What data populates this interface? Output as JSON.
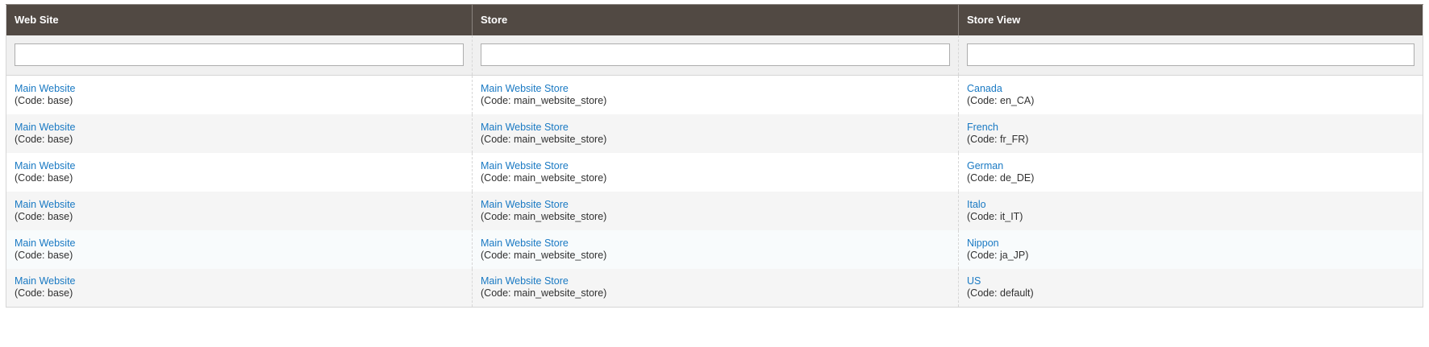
{
  "columns": {
    "website": "Web Site",
    "store": "Store",
    "store_view": "Store View"
  },
  "filters": {
    "website": "",
    "store": "",
    "store_view": ""
  },
  "rows": [
    {
      "website": {
        "name": "Main Website",
        "code": "(Code: base)"
      },
      "store": {
        "name": "Main Website Store",
        "code": "(Code: main_website_store)"
      },
      "store_view": {
        "name": "Canada",
        "code": "(Code: en_CA)"
      }
    },
    {
      "website": {
        "name": "Main Website",
        "code": "(Code: base)"
      },
      "store": {
        "name": "Main Website Store",
        "code": "(Code: main_website_store)"
      },
      "store_view": {
        "name": "French",
        "code": "(Code: fr_FR)"
      }
    },
    {
      "website": {
        "name": "Main Website",
        "code": "(Code: base)"
      },
      "store": {
        "name": "Main Website Store",
        "code": "(Code: main_website_store)"
      },
      "store_view": {
        "name": "German",
        "code": "(Code: de_DE)"
      }
    },
    {
      "website": {
        "name": "Main Website",
        "code": "(Code: base)"
      },
      "store": {
        "name": "Main Website Store",
        "code": "(Code: main_website_store)"
      },
      "store_view": {
        "name": "Italo",
        "code": "(Code: it_IT)"
      }
    },
    {
      "website": {
        "name": "Main Website",
        "code": "(Code: base)"
      },
      "store": {
        "name": "Main Website Store",
        "code": "(Code: main_website_store)"
      },
      "store_view": {
        "name": "Nippon",
        "code": "(Code: ja_JP)"
      }
    },
    {
      "website": {
        "name": "Main Website",
        "code": "(Code: base)"
      },
      "store": {
        "name": "Main Website Store",
        "code": "(Code: main_website_store)"
      },
      "store_view": {
        "name": "US",
        "code": "(Code: default)"
      }
    }
  ]
}
